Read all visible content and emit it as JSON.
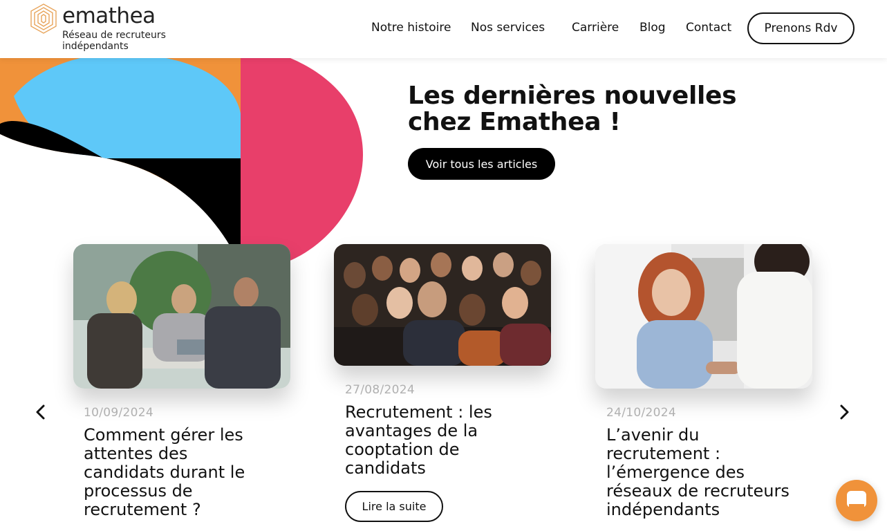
{
  "brand": {
    "name": "emathea",
    "tagline": "Réseau de recruteurs indépendants"
  },
  "nav": {
    "items": [
      "Notre histoire",
      "Nos services",
      "Carrière",
      "Blog",
      "Contact"
    ],
    "cta": "Prenons Rdv"
  },
  "hero": {
    "title": "Les dernières nouvelles chez Emathea !",
    "button": "Voir tous les articles"
  },
  "articles": [
    {
      "date": "10/09/2024",
      "title": "Comment gérer les attentes des candidats durant le processus de recrutement ?",
      "image": "meeting-photo"
    },
    {
      "date": "27/08/2024",
      "title": "Recrutement : les avantages de la cooptation de candidats",
      "image": "team-photo",
      "read_more": "Lire la suite"
    },
    {
      "date": "24/10/2024",
      "title": "L’avenir du recrutement : l’émergence des réseaux de recruteurs indépendants",
      "image": "handshake-photo"
    }
  ],
  "icons": {
    "prev": "chevron-left-icon",
    "next": "chevron-right-icon",
    "chat": "chat-icon"
  },
  "colors": {
    "orange": "#f0923a",
    "blue": "#5ec8f8",
    "pink": "#e83f6a",
    "black": "#000000"
  }
}
